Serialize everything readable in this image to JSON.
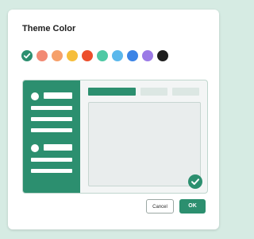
{
  "dialog": {
    "title": "Theme Color"
  },
  "swatches": [
    {
      "name": "green",
      "color": "#2c8f6f",
      "selected": true
    },
    {
      "name": "salmon",
      "color": "#f28a74",
      "selected": false
    },
    {
      "name": "light-orange",
      "color": "#f6a06a",
      "selected": false
    },
    {
      "name": "yellow",
      "color": "#f6be3b",
      "selected": false
    },
    {
      "name": "red-orange",
      "color": "#ec4f2c",
      "selected": false
    },
    {
      "name": "mint",
      "color": "#4fc9a4",
      "selected": false
    },
    {
      "name": "sky-blue",
      "color": "#5bb8ec",
      "selected": false
    },
    {
      "name": "blue",
      "color": "#3b84e6",
      "selected": false
    },
    {
      "name": "purple",
      "color": "#9b7ae6",
      "selected": false
    },
    {
      "name": "black",
      "color": "#1e1e1e",
      "selected": false
    }
  ],
  "preview": {
    "accent_color": "#2c8f6f",
    "inactive_tab_color": "#dce7e3",
    "check_icon": "check-circle-icon"
  },
  "buttons": {
    "cancel_label": "Cancel",
    "ok_label": "OK"
  }
}
